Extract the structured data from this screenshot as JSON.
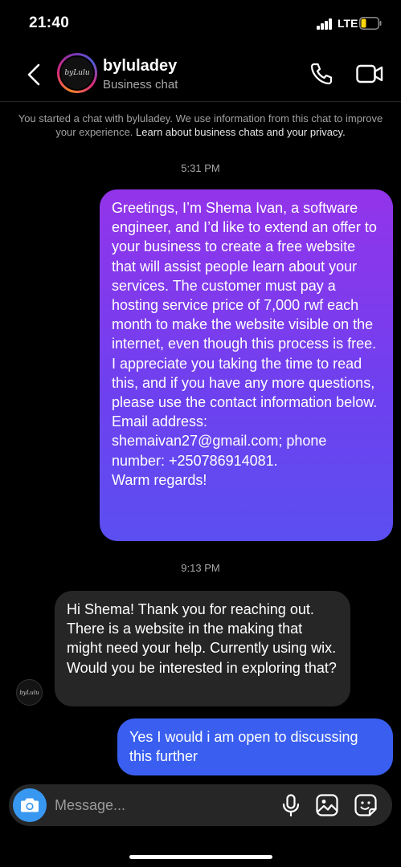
{
  "status_bar": {
    "time": "21:40",
    "network": "LTE",
    "battery_color": "#ffd60a"
  },
  "header": {
    "name": "byluladey",
    "subtitle": "Business chat",
    "avatar_text": "byLulu"
  },
  "disclosure": {
    "text": "You started a chat with byluladey. We use information from this chat to improve your experience. ",
    "link": "Learn about business chats and your privacy."
  },
  "messages": [
    {
      "timestamp": "5:31 PM",
      "direction": "outgoing",
      "paragraphs": [
        "Greetings, I’m Shema Ivan, a software engineer, and I’d like to extend an offer to your business to create a free website that will assist people learn about your services. The customer must pay a hosting service price of 7,000 rwf each month to make the website visible on the internet, even though this process is free. I appreciate you taking the time to read this, and if you have any more questions, please use the contact information below.",
        "Email address: shemaivan27@gmail.com; phone number: +250786914081.",
        "Warm regards!"
      ]
    },
    {
      "timestamp": "9:13 PM",
      "direction": "incoming",
      "paragraphs": [
        "Hi Shema! Thank you for reaching out. There is a website in the making that might need your help. Currently using wix. Would you be interested in exploring that?"
      ]
    },
    {
      "direction": "outgoing",
      "paragraphs": [
        "Yes I would i am open to discussing this further"
      ]
    }
  ],
  "composer": {
    "placeholder": "Message...",
    "icons": [
      "camera-icon",
      "microphone-icon",
      "gallery-icon",
      "sticker-icon"
    ]
  },
  "colors": {
    "outgoing_gradient_top": "#9334ea",
    "outgoing_gradient_bottom": "#5b4ff0",
    "outgoing_blue": "#3a5ff0",
    "incoming": "#262626",
    "camera": "#3897f0"
  }
}
